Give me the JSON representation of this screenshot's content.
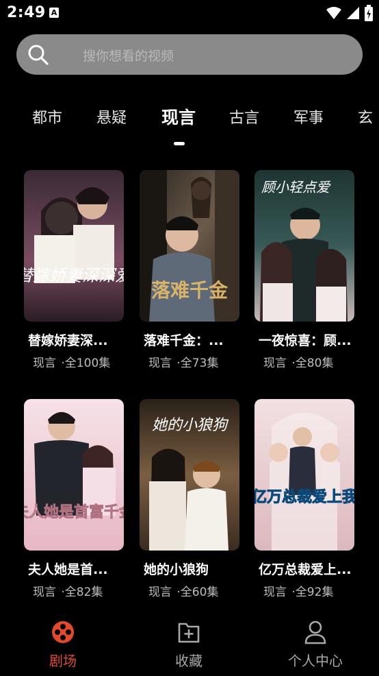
{
  "status_bar": {
    "time": "2:49",
    "notification_glyph": "A"
  },
  "search": {
    "placeholder": "搜你想看的视频"
  },
  "tabs": [
    {
      "label": "都市",
      "active": false
    },
    {
      "label": "悬疑",
      "active": false
    },
    {
      "label": "现言",
      "active": true
    },
    {
      "label": "古言",
      "active": false
    },
    {
      "label": "军事",
      "active": false
    },
    {
      "label": "玄",
      "active": false
    }
  ],
  "dramas": [
    {
      "title": "替嫁娇妻深...",
      "genre": "现言",
      "episodes": "·全100集",
      "poster_text": "替嫁娇妻深深爱",
      "accent": "#c77b9a"
    },
    {
      "title": "落难千金：...",
      "genre": "现言",
      "episodes": "·全73集",
      "poster_text": "落难千金",
      "accent": "#b88a43"
    },
    {
      "title": "一夜惊喜：顾...",
      "genre": "现言",
      "episodes": "·全80集",
      "poster_text": "顾小轻点爱",
      "accent": "#2e4b4a"
    },
    {
      "title": "夫人她是首...",
      "genre": "现言",
      "episodes": "·全82集",
      "poster_text": "夫人她是首富千金",
      "accent": "#e7b7c4"
    },
    {
      "title": "她的小狼狗",
      "genre": "现言",
      "episodes": "·全60集",
      "poster_text": "她的小狼狗",
      "accent": "#a9875f"
    },
    {
      "title": "亿万总裁爱上...",
      "genre": "现言",
      "episodes": "·全92集",
      "poster_text": "亿万总裁爱上我",
      "accent": "#e8c7cc"
    }
  ],
  "bottom_nav": [
    {
      "label": "剧场",
      "icon": "film-reel-icon",
      "active": true
    },
    {
      "label": "收藏",
      "icon": "bookmark-add-icon",
      "active": false
    },
    {
      "label": "个人中心",
      "icon": "user-icon",
      "active": false
    }
  ],
  "colors": {
    "accent": "#e3492c",
    "search_bg": "#8a8a8a",
    "background": "#000000"
  }
}
